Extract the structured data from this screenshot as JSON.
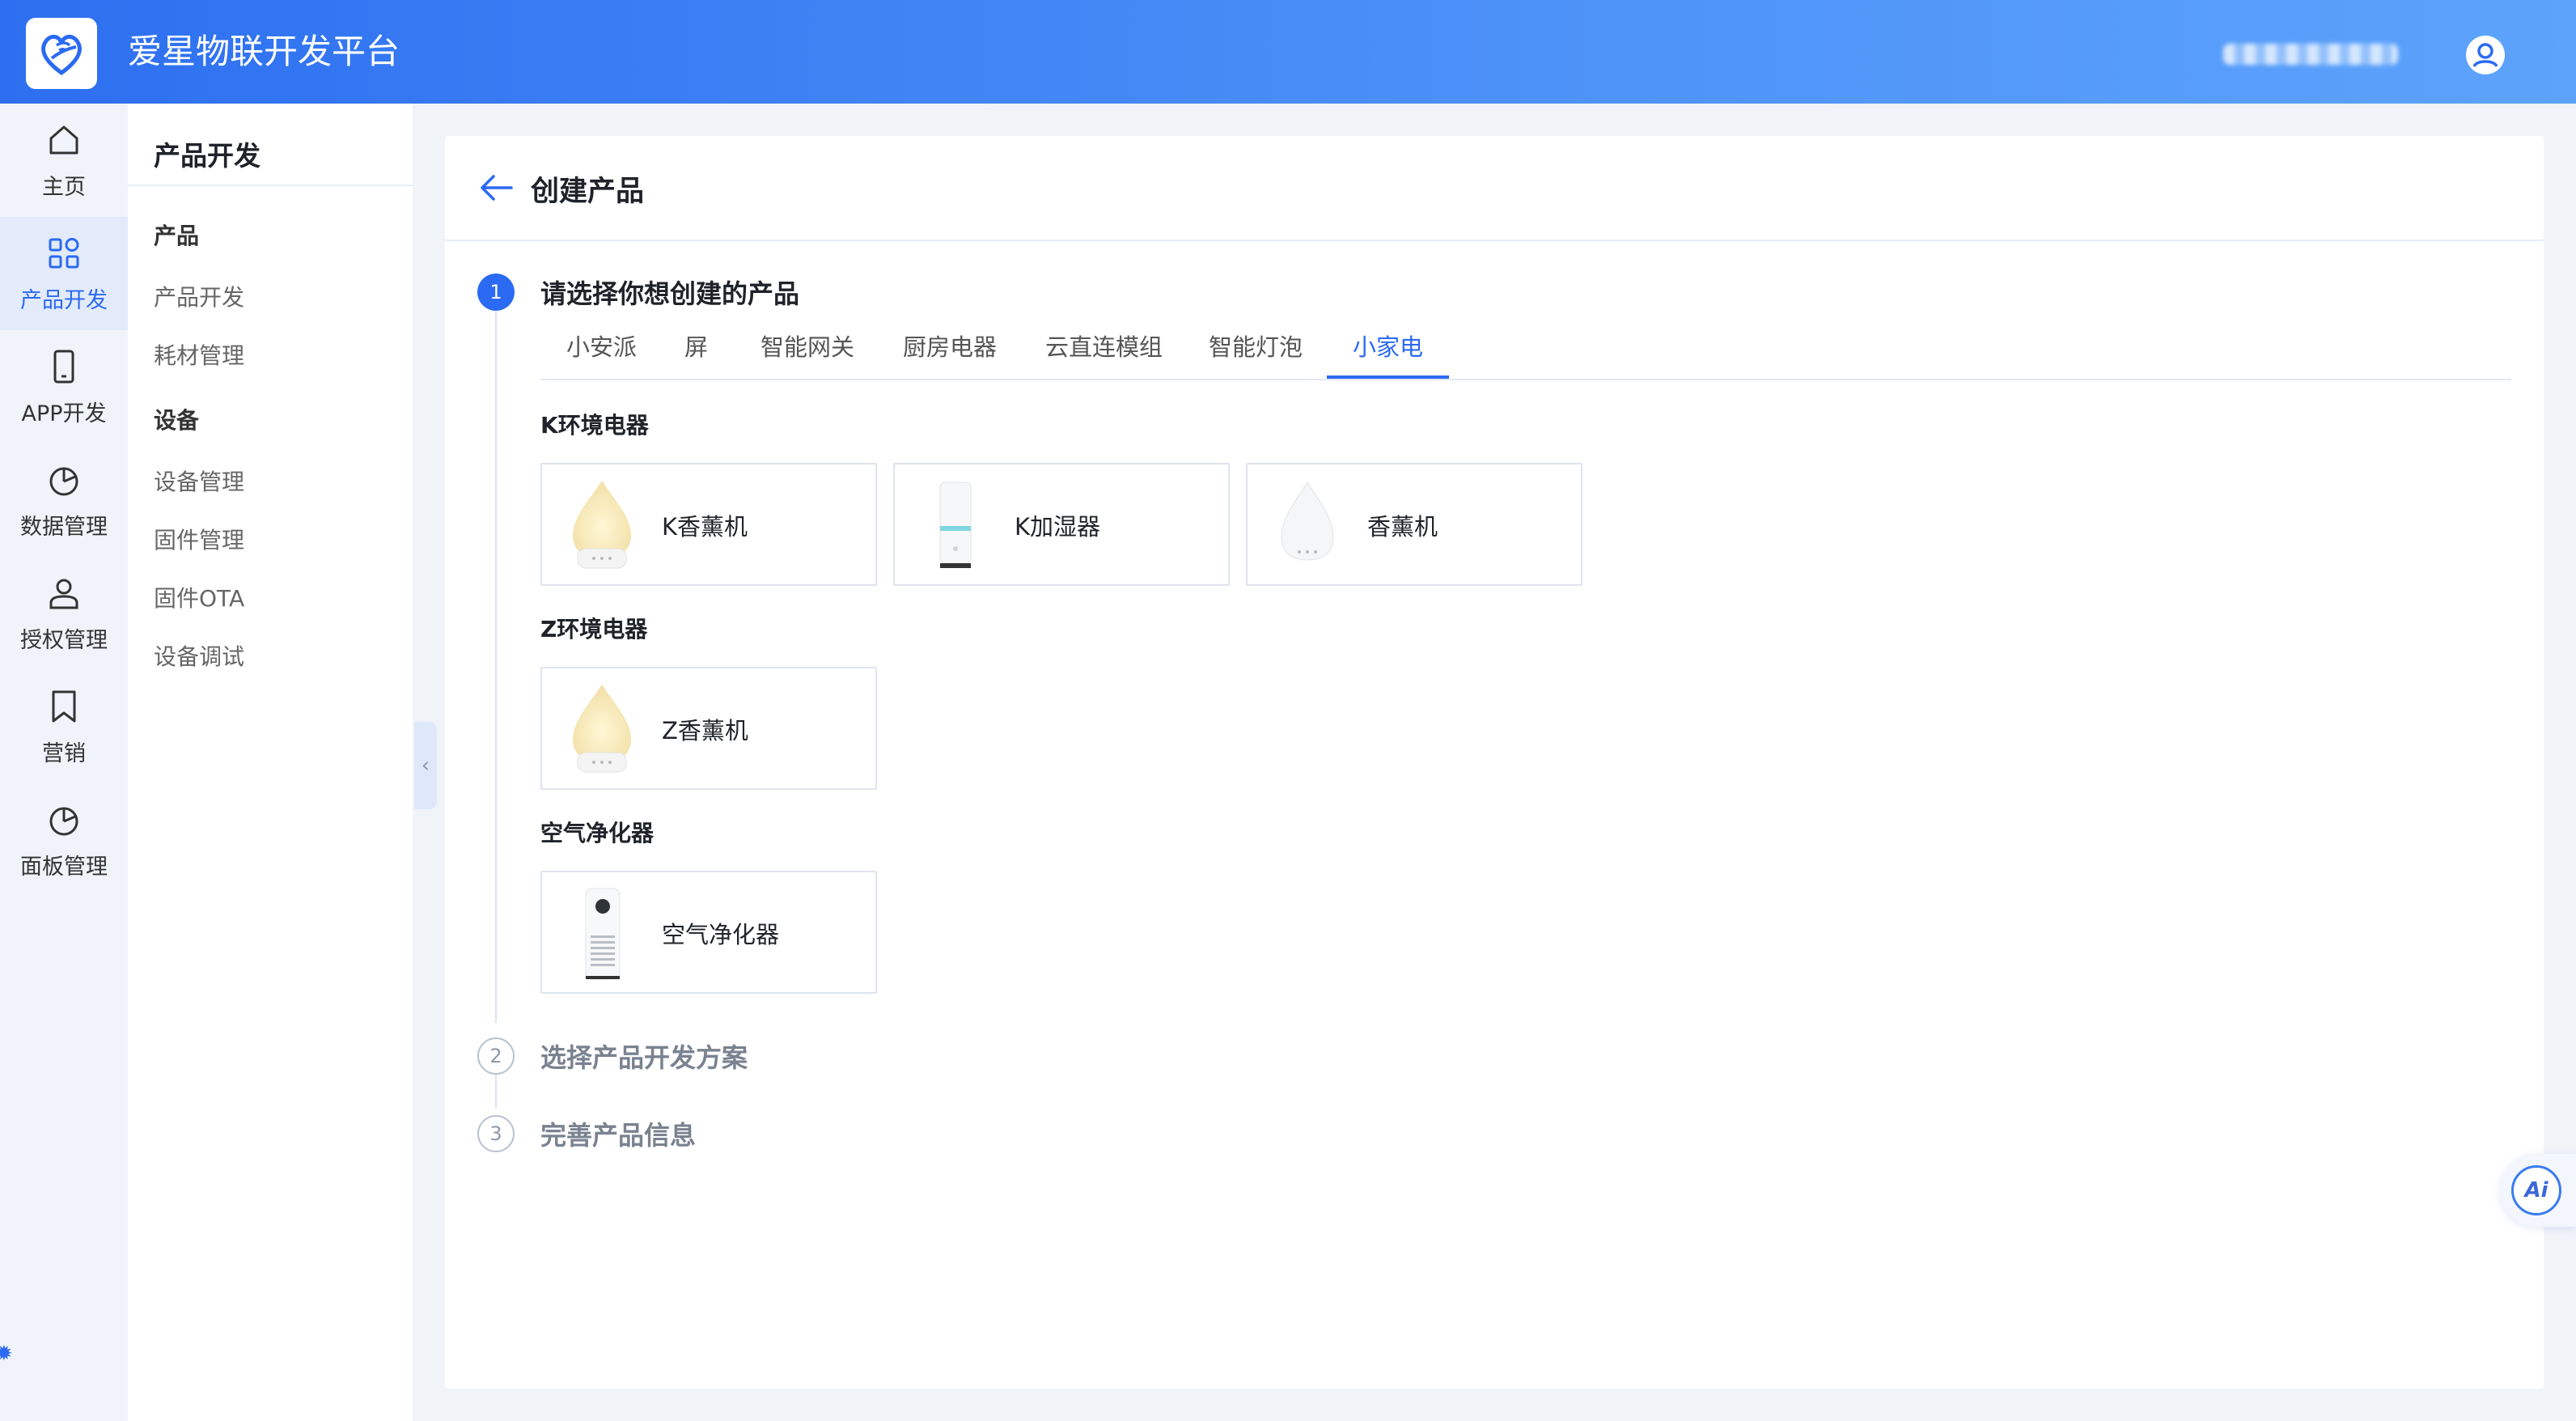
{
  "header": {
    "app_title": "爱星物联开发平台"
  },
  "icon_nav": {
    "items": [
      {
        "label": "主页",
        "icon": "home-icon"
      },
      {
        "label": "产品开发",
        "icon": "grid-icon",
        "active": true
      },
      {
        "label": "APP开发",
        "icon": "phone-icon"
      },
      {
        "label": "数据管理",
        "icon": "pie-chart-icon"
      },
      {
        "label": "授权管理",
        "icon": "user-icon"
      },
      {
        "label": "营销",
        "icon": "bookmark-icon"
      },
      {
        "label": "面板管理",
        "icon": "pie-chart-icon"
      }
    ]
  },
  "sub_sidebar": {
    "title": "产品开发",
    "groups": [
      {
        "label": "产品",
        "links": [
          "产品开发",
          "耗材管理"
        ]
      },
      {
        "label": "设备",
        "links": [
          "设备管理",
          "固件管理",
          "固件OTA",
          "设备调试"
        ]
      }
    ]
  },
  "page": {
    "title": "创建产品",
    "steps": [
      {
        "number": "1",
        "title": "请选择你想创建的产品",
        "active": true
      },
      {
        "number": "2",
        "title": "选择产品开发方案",
        "active": false
      },
      {
        "number": "3",
        "title": "完善产品信息",
        "active": false
      }
    ],
    "tabs": [
      "小安派",
      "屏",
      "智能网关",
      "厨房电器",
      "云直连模组",
      "智能灯泡",
      "小家电"
    ],
    "active_tab": "小家电",
    "categories": [
      {
        "title": "K环境电器",
        "products": [
          "K香薰机",
          "K加湿器",
          "香薰机"
        ]
      },
      {
        "title": "Z环境电器",
        "products": [
          "Z香薰机"
        ]
      },
      {
        "title": "空气净化器",
        "products": [
          "空气净化器"
        ]
      }
    ]
  },
  "ai_button": {
    "label": "Ai"
  },
  "colors": {
    "primary": "#2b6af2",
    "header_start": "#2d6ff0",
    "header_end": "#5da3fb"
  }
}
